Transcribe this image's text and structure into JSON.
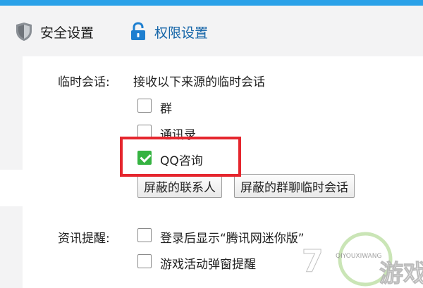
{
  "tabs": {
    "security": "安全设置",
    "permission": "权限设置"
  },
  "temp_chat": {
    "label": "临时会话:",
    "description": "接收以下来源的临时会话",
    "options": [
      {
        "label": "群",
        "checked": false
      },
      {
        "label": "通讯录",
        "checked": false
      },
      {
        "label": "QQ咨询",
        "checked": true
      }
    ],
    "buttons": {
      "blocked_contacts": "屏蔽的联系人",
      "blocked_group_chats": "屏蔽的群聊临时会话"
    }
  },
  "news_reminder": {
    "label": "资讯提醒:",
    "options": [
      {
        "label": "登录后显示“腾讯网迷你版”",
        "checked": false
      },
      {
        "label": "游戏活动弹窗提醒",
        "checked": false
      }
    ]
  },
  "watermark": {
    "number": "7",
    "brand": "游戏",
    "sub": "QIYOUXIWANG"
  },
  "colors": {
    "top_bar": "#2aa1e8",
    "active_tab": "#1565a8",
    "check_green": "#35b341",
    "highlight_red": "#e5262e"
  }
}
